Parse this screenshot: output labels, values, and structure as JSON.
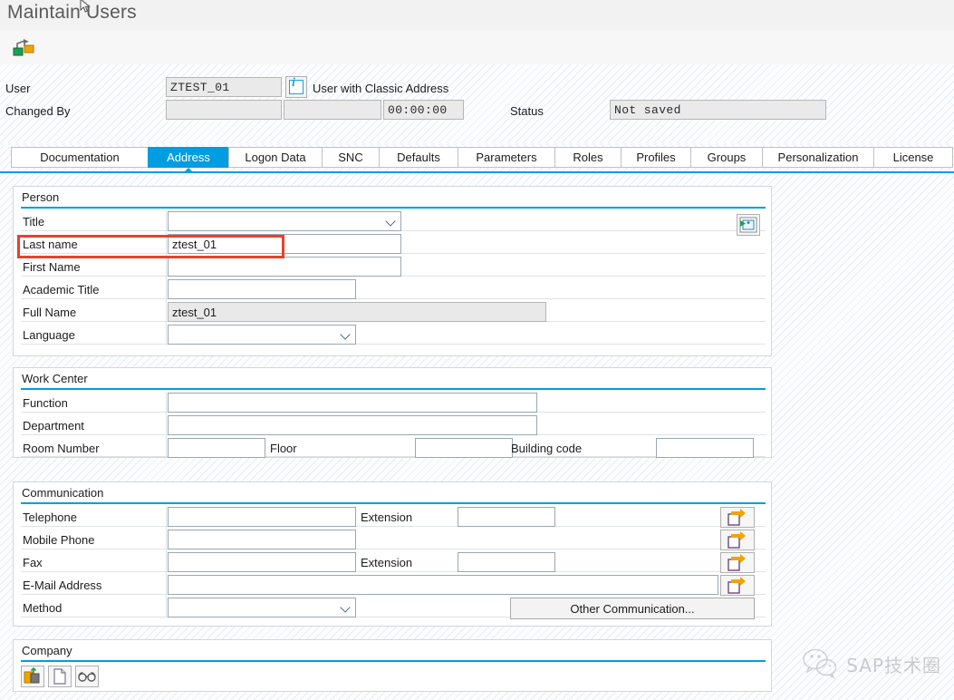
{
  "window": {
    "title": "Maintain Users"
  },
  "toolbar": {
    "other_user_icon": "other-user-icon"
  },
  "header": {
    "user_label": "User",
    "user_value": "ZTEST_01",
    "info_icon": "info-icon",
    "user_type_text": "User with Classic Address",
    "changed_by_label": "Changed By",
    "changed_by_value": "",
    "changed_date_value": "",
    "changed_time_value": "00:00:00",
    "status_label": "Status",
    "status_value": "Not saved"
  },
  "tabs": [
    {
      "label": "Documentation",
      "active": false
    },
    {
      "label": "Address",
      "active": true
    },
    {
      "label": "Logon Data",
      "active": false
    },
    {
      "label": "SNC",
      "active": false
    },
    {
      "label": "Defaults",
      "active": false
    },
    {
      "label": "Parameters",
      "active": false
    },
    {
      "label": "Roles",
      "active": false
    },
    {
      "label": "Profiles",
      "active": false
    },
    {
      "label": "Groups",
      "active": false
    },
    {
      "label": "Personalization",
      "active": false
    },
    {
      "label": "License",
      "active": false
    }
  ],
  "person": {
    "section_title": "Person",
    "assign_address_icon": "assign-address-icon",
    "title_label": "Title",
    "title_value": "",
    "last_name_label": "Last name",
    "last_name_value": "ztest_01",
    "first_name_label": "First Name",
    "first_name_value": "",
    "academic_title_label": "Academic Title",
    "academic_title_value": "",
    "full_name_label": "Full Name",
    "full_name_value": "ztest_01",
    "language_label": "Language",
    "language_value": ""
  },
  "work_center": {
    "section_title": "Work Center",
    "function_label": "Function",
    "function_value": "",
    "department_label": "Department",
    "department_value": "",
    "room_number_label": "Room Number",
    "room_number_value": "",
    "floor_label": "Floor",
    "floor_value": "",
    "building_code_label": "Building code",
    "building_code_value": ""
  },
  "communication": {
    "section_title": "Communication",
    "telephone_label": "Telephone",
    "telephone_value": "",
    "telephone_extension_label": "Extension",
    "telephone_extension_value": "",
    "mobile_phone_label": "Mobile Phone",
    "mobile_phone_value": "",
    "fax_label": "Fax",
    "fax_value": "",
    "fax_extension_label": "Extension",
    "fax_extension_value": "",
    "email_label": "E-Mail Address",
    "email_value": "",
    "method_label": "Method",
    "method_value": "",
    "other_communication_button": "Other Communication...",
    "detail_icon": "navigate-detail-icon"
  },
  "company": {
    "section_title": "Company",
    "create_icon": "create-company-icon",
    "document_icon": "document-icon",
    "display_icon": "glasses-display-icon"
  },
  "annotation": {
    "highlight_color": "#e8412f",
    "highlight_target": "Last name"
  },
  "watermark": {
    "text": "SAP技术圈",
    "icon": "wechat-icon"
  }
}
